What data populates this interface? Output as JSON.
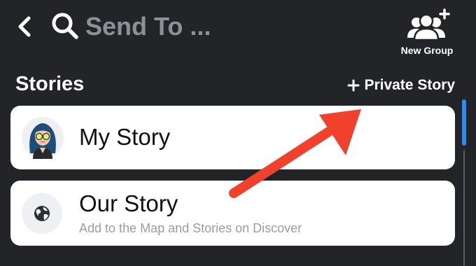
{
  "header": {
    "back_icon": "chevron-left-icon",
    "search_icon": "search-icon",
    "search_placeholder": "Send To ...",
    "new_group_icon": "group-add-icon",
    "new_group_label": "New Group"
  },
  "stories": {
    "section_title": "Stories",
    "private_story_icon": "plus-icon",
    "private_story_label": "Private Story",
    "items": [
      {
        "title": "My Story",
        "icon": "bitmoji-avatar"
      },
      {
        "title": "Our Story",
        "icon": "globe-icon",
        "subtitle": "Add to the Map and Stories on Discover"
      }
    ]
  },
  "colors": {
    "background": "#222428",
    "card": "#ffffff",
    "annotation_arrow": "#f0412c",
    "scroll_thumb": "#2f8bf2",
    "placeholder": "#8e9095"
  }
}
